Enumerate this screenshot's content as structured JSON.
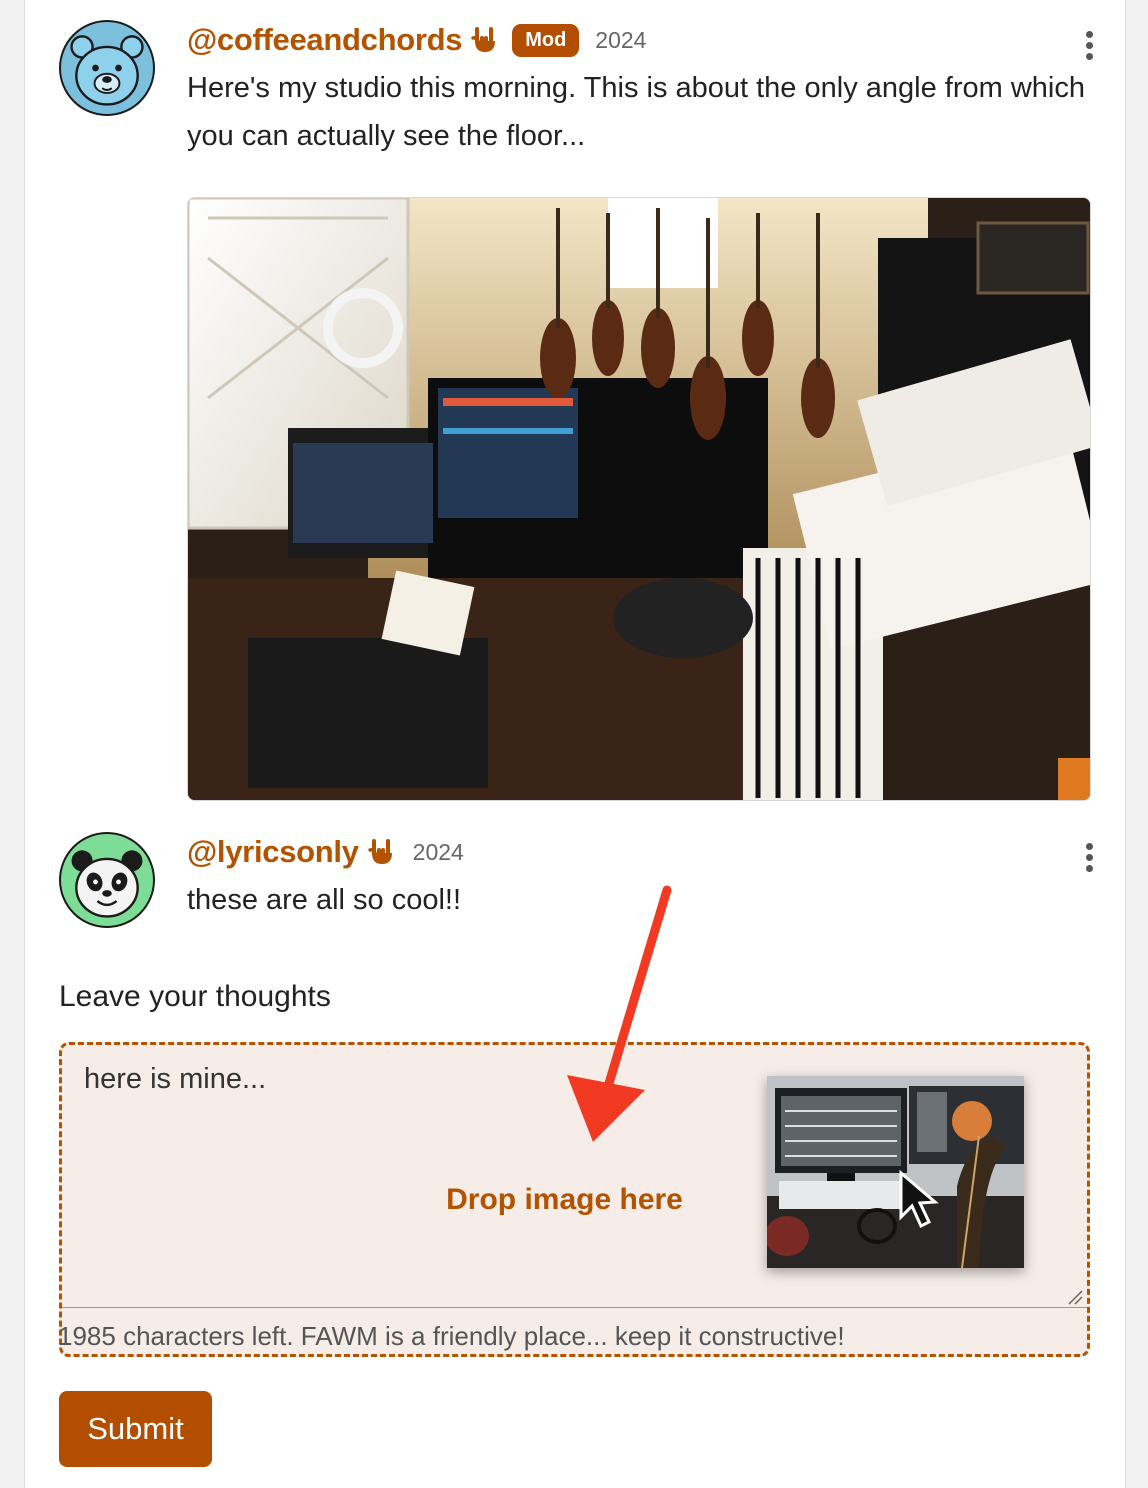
{
  "comments": [
    {
      "username": "@coffeeandchords",
      "badge": "Mod",
      "year": "2024",
      "text": "Here's my studio this morning. This is about the only angle from which you can actually see the floor..."
    },
    {
      "username": "@lyricsonly",
      "year": "2024",
      "text": "these are all so cool!!"
    }
  ],
  "form": {
    "label": "Leave your thoughts",
    "textarea_value": "here is mine...",
    "drop_label": "Drop image here",
    "helper": "1985 characters left. FAWM is a friendly place... keep it constructive!",
    "submit_label": "Submit"
  },
  "colors": {
    "accent": "#b35300",
    "button": "#b34d00",
    "dropzone_bg": "#f6ece8",
    "annotation_arrow": "#f23a22"
  },
  "icons": [
    "bear-avatar-icon",
    "rock-hand-icon",
    "kebab-menu-icon",
    "panda-avatar-icon",
    "resize-handle-icon",
    "cursor-icon"
  ]
}
